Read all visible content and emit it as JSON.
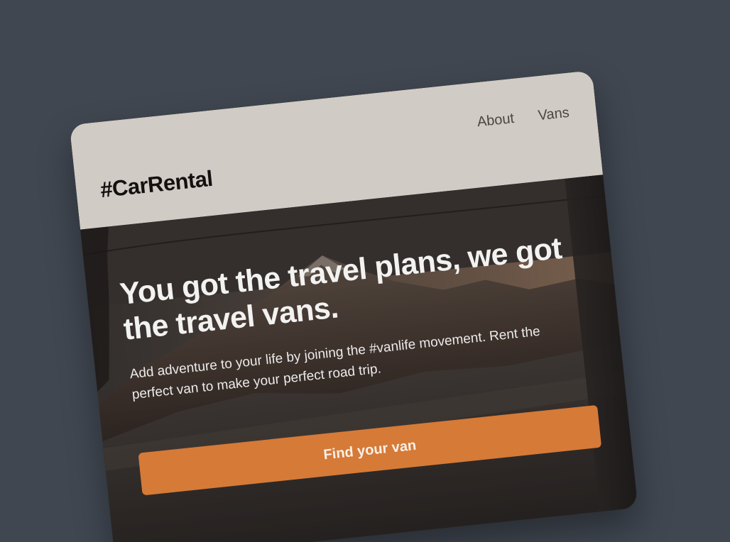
{
  "header": {
    "logo": "#CarRental",
    "nav": [
      {
        "label": "About"
      },
      {
        "label": "Vans"
      }
    ]
  },
  "hero": {
    "title": "You got the travel plans, we got the travel vans.",
    "subtitle": "Add adventure to your life by joining the #vanlife movement. Rent the perfect van to make your perfect road trip.",
    "cta": "Find your van"
  },
  "colors": {
    "page_background": "#404751",
    "header_background": "#d0cbc4",
    "cta_background": "#d67a37",
    "hero_text": "#f2f2f1"
  },
  "icons": {
    "hero_image": "mountain-lake-van-window-photo"
  }
}
